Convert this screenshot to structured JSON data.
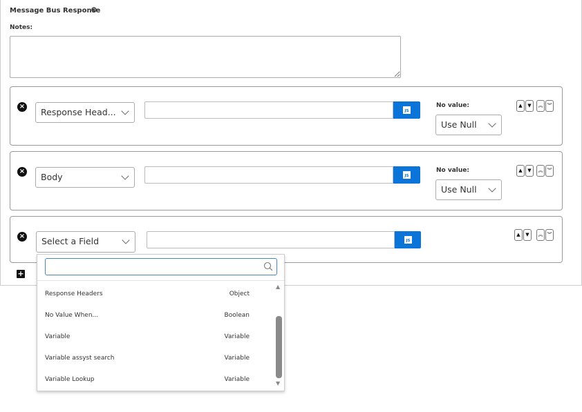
{
  "header": {
    "title": "Message Bus Response",
    "notes_label": "Notes:",
    "notes_value": ""
  },
  "rows": [
    {
      "field": "Response Head...",
      "value": "",
      "js_label": "JS",
      "no_value_label": "No value:",
      "no_value": "Use Null"
    },
    {
      "field": "Body",
      "value": "",
      "js_label": "JS",
      "no_value_label": "No value:",
      "no_value": "Use Null"
    },
    {
      "field": "Select a Field",
      "value": "",
      "js_label": "JS"
    }
  ],
  "dropdown": {
    "search_value": "",
    "items": [
      {
        "label": "Response Headers",
        "type": "Object"
      },
      {
        "label": "No Value When...",
        "type": "Boolean"
      },
      {
        "label": "Variable",
        "type": "Variable"
      },
      {
        "label": "Variable assyst search",
        "type": "Variable"
      },
      {
        "label": "Variable Lookup",
        "type": "Variable"
      }
    ],
    "scroll_position_fraction": 0.6
  },
  "icons": {
    "gear": "gear-icon",
    "remove": "close-circle-icon",
    "add": "plus-icon",
    "search": "search-icon"
  }
}
